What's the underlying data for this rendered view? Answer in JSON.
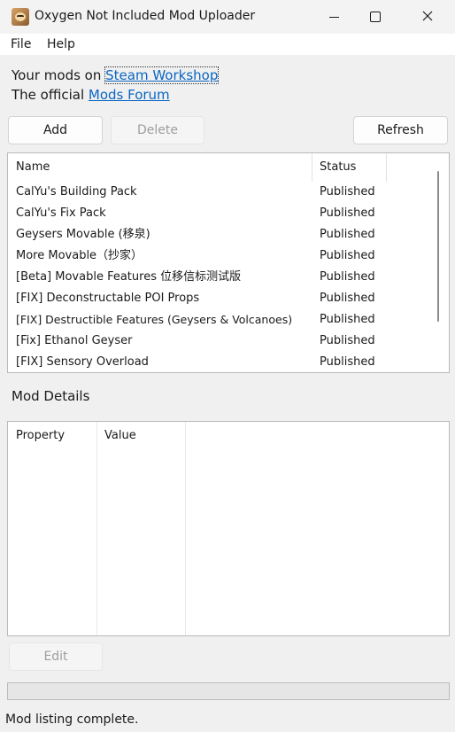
{
  "window": {
    "title": "Oxygen Not Included Mod Uploader"
  },
  "menu": [
    "File",
    "Help"
  ],
  "links": {
    "line1_prefix": "Your mods on ",
    "line1_link": "Steam Workshop",
    "line2_prefix": "The official ",
    "line2_link": "Mods Forum"
  },
  "toolbar": {
    "add_label": "Add",
    "delete_label": "Delete",
    "refresh_label": "Refresh"
  },
  "mod_list": {
    "columns": [
      "Name",
      "Status"
    ],
    "rows": [
      {
        "name": "CalYu's Building Pack",
        "status": "Published"
      },
      {
        "name": "CalYu's Fix Pack",
        "status": "Published"
      },
      {
        "name": "Geysers Movable (移泉)",
        "status": "Published"
      },
      {
        "name": "More Movable（抄家）",
        "status": "Published"
      },
      {
        "name": "[Beta] Movable Features 位移信标测试版",
        "status": "Published"
      },
      {
        "name": "[FIX] Deconstructable POI Props",
        "status": "Published"
      },
      {
        "name": "[FIX] Destructible Features (Geysers & Volcanoes)",
        "status": "Published"
      },
      {
        "name": "[Fix] Ethanol Geyser",
        "status": "Published"
      },
      {
        "name": "[FIX] Sensory Overload",
        "status": "Published"
      }
    ]
  },
  "details": {
    "title": "Mod Details",
    "columns": [
      "Property",
      "Value"
    ]
  },
  "edit_label": "Edit",
  "progress": {
    "value": 0
  },
  "status": "Mod listing complete.",
  "colors": {
    "link": "#0a66c2",
    "window_bg": "#f0f0f0",
    "disabled_text": "#9e9e9e"
  }
}
